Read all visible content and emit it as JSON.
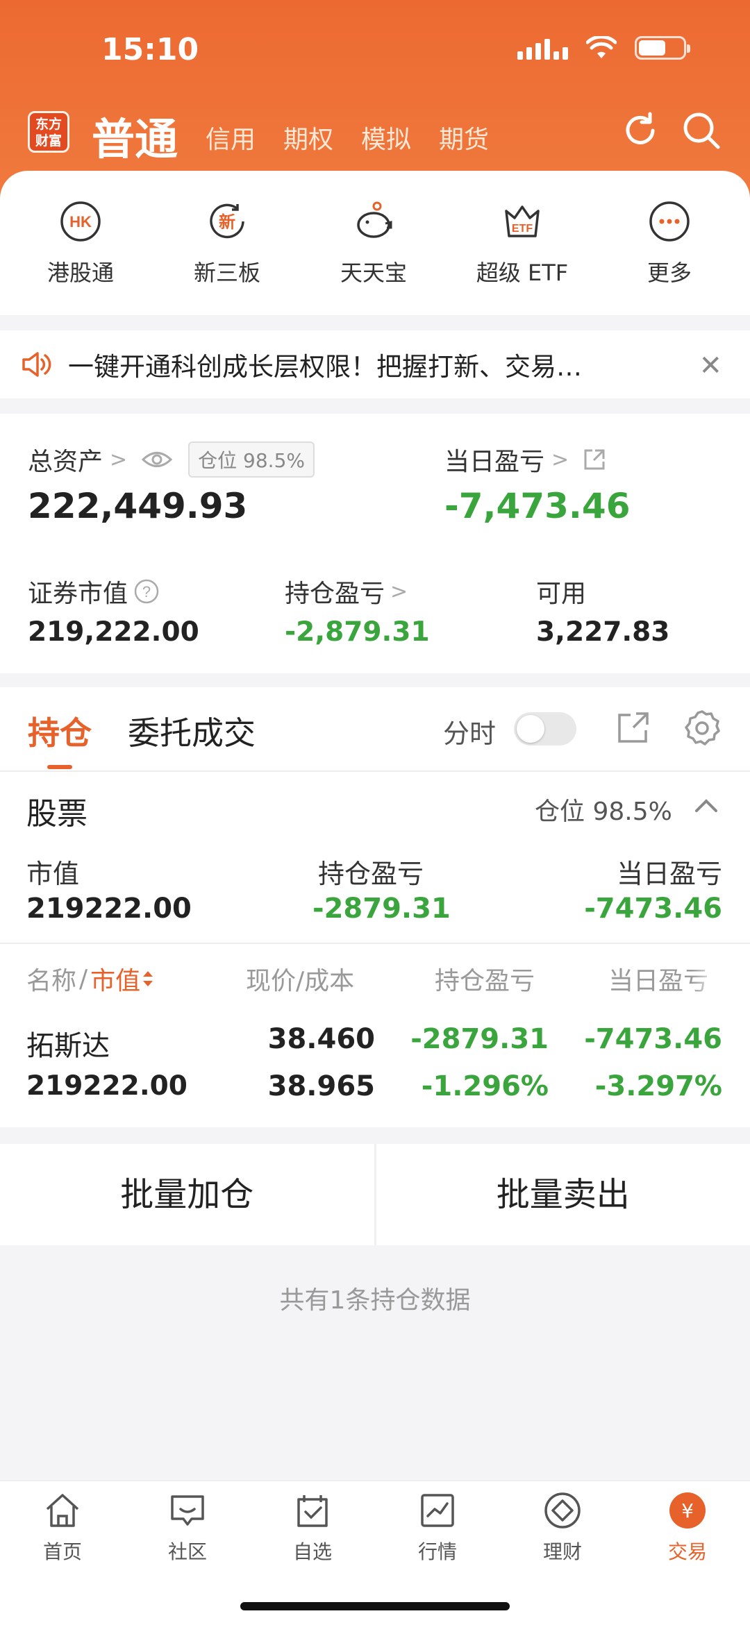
{
  "status": {
    "time": "15:10"
  },
  "header": {
    "logo": [
      "东方",
      "财富"
    ],
    "active_tab": "普通",
    "tabs": [
      "信用",
      "期权",
      "模拟",
      "期货"
    ]
  },
  "quick": [
    {
      "label": "港股通",
      "icon": "hk-icon",
      "glyph": "HK"
    },
    {
      "label": "新三板",
      "icon": "new-three-board-icon",
      "glyph": "新"
    },
    {
      "label": "天天宝",
      "icon": "piggy-bank-icon",
      "glyph": ""
    },
    {
      "label": "超级 ETF",
      "icon": "etf-crown-icon",
      "glyph": "ETF"
    },
    {
      "label": "更多",
      "icon": "more-icon",
      "glyph": "···"
    }
  ],
  "banner": {
    "text": "一键开通科创成长层权限！把握打新、交易…"
  },
  "assets": {
    "total_label": "总资产",
    "position_badge": "仓位 98.5%",
    "total_value": "222,449.93",
    "daily_pnl_label": "当日盈亏",
    "daily_pnl_value": "-7,473.46",
    "market_value_label": "证券市值",
    "market_value": "219,222.00",
    "holding_pnl_label": "持仓盈亏",
    "holding_pnl": "-2,879.31",
    "available_label": "可用",
    "available": "3,227.83"
  },
  "holdings": {
    "tab_active": "持仓",
    "tab_other": "委托成交",
    "timeshare_label": "分时",
    "section_title": "股票",
    "section_position": "仓位 98.5%",
    "summary": {
      "mv_label": "市值",
      "mv": "219222.00",
      "hold_label": "持仓盈亏",
      "hold": "-2879.31",
      "daily_label": "当日盈亏",
      "daily": "-7473.46"
    },
    "columns": {
      "name": "名称",
      "slash": "/",
      "mv": "市值",
      "price": "现价/成本",
      "hold": "持仓盈亏",
      "daily": "当日盈亏"
    },
    "rows": [
      {
        "name": "拓斯达",
        "mv": "219222.00",
        "price": "38.460",
        "cost": "38.965",
        "hold_pnl": "-2879.31",
        "hold_pct": "-1.296%",
        "daily_pnl": "-7473.46",
        "daily_pct": "-3.297%"
      }
    ]
  },
  "actions": {
    "add": "批量加仓",
    "sell": "批量卖出"
  },
  "footer_note": "共有1条持仓数据",
  "tabbar": [
    {
      "label": "首页",
      "icon": "home-icon"
    },
    {
      "label": "社区",
      "icon": "community-icon"
    },
    {
      "label": "自选",
      "icon": "watchlist-icon"
    },
    {
      "label": "行情",
      "icon": "market-icon"
    },
    {
      "label": "理财",
      "icon": "wealth-icon"
    },
    {
      "label": "交易",
      "icon": "trade-icon",
      "active": true
    }
  ],
  "colors": {
    "brand": "#ec6a32",
    "loss_green": "#3aa53c",
    "accent": "#e6622a"
  }
}
